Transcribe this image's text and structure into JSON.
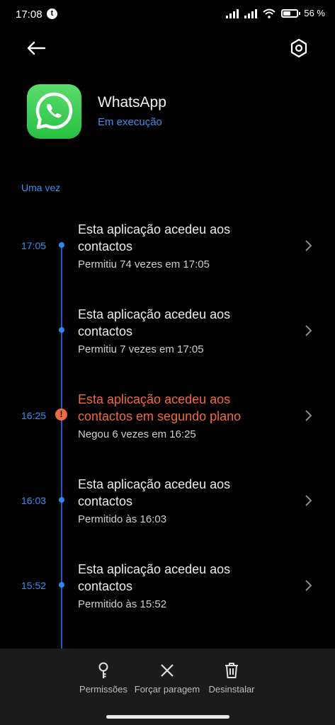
{
  "status_bar": {
    "time": "17:08",
    "notification_glyph": "t",
    "battery": "56 %",
    "battery_level": 0.56
  },
  "app": {
    "name": "WhatsApp",
    "status": "Em execução"
  },
  "section_label": "Uma vez",
  "entries": [
    {
      "time": "17:05",
      "title_line1": "Esta aplicação acedeu aos",
      "title_line2": "contactos",
      "subtitle": "Permitiu 74 vezes em 17:05",
      "warning": false
    },
    {
      "time": "",
      "title_line1": "Esta aplicação acedeu aos",
      "title_line2": "contactos",
      "subtitle": "Permitiu 7 vezes em 17:05",
      "warning": false
    },
    {
      "time": "16:25",
      "title_line1": "Esta aplicação acedeu aos",
      "title_line2": "contactos em segundo plano",
      "subtitle": "Negou 6 vezes em 16:25",
      "warning": true
    },
    {
      "time": "16:03",
      "title_line1": "Esta aplicação acedeu aos",
      "title_line2": "contactos",
      "subtitle": "Permitido às 16:03",
      "warning": false
    },
    {
      "time": "15:52",
      "title_line1": "Esta aplicação acedeu aos",
      "title_line2": "contactos",
      "subtitle": "Permitido às 15:52",
      "warning": false
    }
  ],
  "actions": {
    "permissions": "Permissões",
    "force_stop": "Forçar paragem",
    "uninstall": "Desinstalar"
  },
  "colors": {
    "accent": "#3b8ff0",
    "warning": "#f06a3c",
    "app_icon": "#34c759"
  }
}
